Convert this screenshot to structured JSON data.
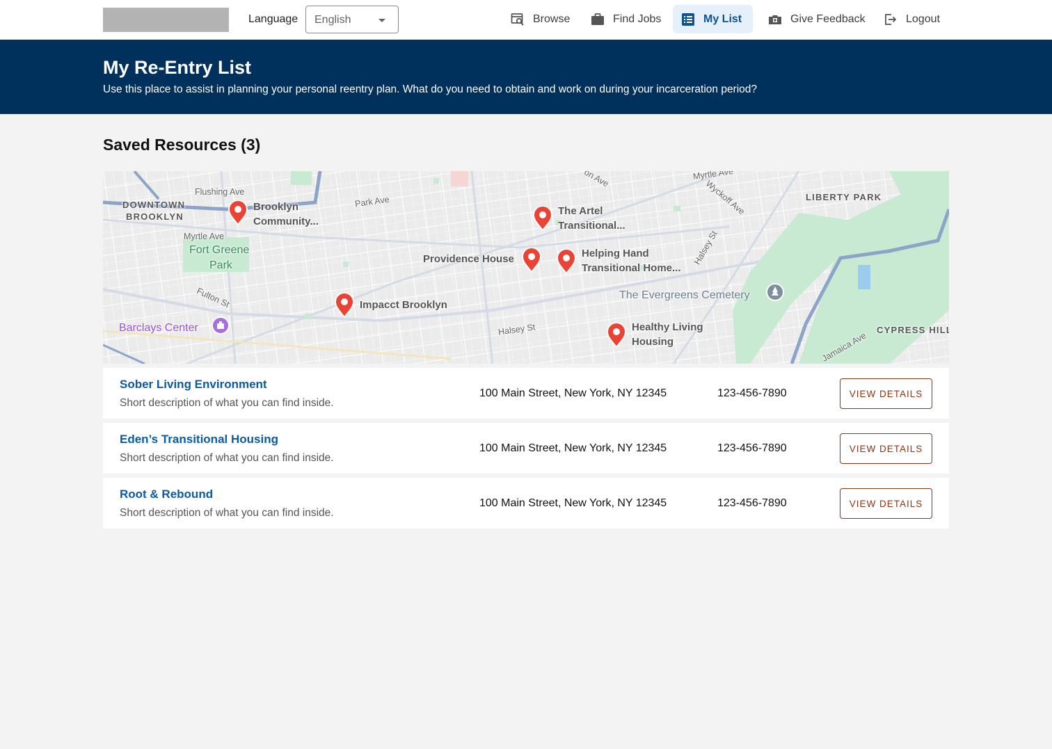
{
  "header": {
    "language_label": "Language",
    "language_value": "English",
    "nav": [
      {
        "label": "Browse",
        "icon": "browse-icon"
      },
      {
        "label": "Find Jobs",
        "icon": "briefcase-icon"
      },
      {
        "label": "My List",
        "icon": "list-icon",
        "active": true
      },
      {
        "label": "Give Feedback",
        "icon": "feedback-icon"
      },
      {
        "label": "Logout",
        "icon": "logout-icon"
      }
    ]
  },
  "banner": {
    "title": "My Re-Entry List",
    "subtitle": "Use this place to assist in planning your personal reentry plan. What do you need to obtain and work on during your incarceration period?"
  },
  "saved": {
    "title": "Saved Resources (3)"
  },
  "map": {
    "markers": [
      {
        "line1": "Brooklyn",
        "line2": "Community..."
      },
      {
        "line1": "The Artel",
        "line2": "Transitional..."
      },
      {
        "line1": "Providence House",
        "line2": ""
      },
      {
        "line1": "Helping Hand",
        "line2": "Transitional Home..."
      },
      {
        "line1": "Impacct Brooklyn",
        "line2": ""
      },
      {
        "line1": "Healthy Living",
        "line2": "Housing"
      }
    ],
    "places": {
      "downtown_1": "DOWNTOWN",
      "downtown_2": "BROOKLYN",
      "fort_greene_1": "Fort Greene",
      "fort_greene_2": "Park",
      "barclays": "Barclays Center",
      "evergreens": "The Evergreens Cemetery",
      "liberty": "LIBERTY PARK",
      "cypress": "CYPRESS HILL"
    },
    "streets": {
      "flushing": "Flushing Ave",
      "park": "Park Ave",
      "myrtle_w": "Myrtle Ave",
      "myrtle_e": "Myrtle Ave",
      "fulton": "Fulton St",
      "halsey_st": "Halsey St",
      "wyckoff": "Wyckoff Ave",
      "halsey_ne": "Halsey St",
      "jamaica": "Jamaica Ave",
      "on_ave": "on Ave"
    },
    "colors": {
      "marker": "#ea4335",
      "park": "#c8ead2",
      "highway": "#8da4c9"
    }
  },
  "resources": [
    {
      "name": "Sober Living Environment",
      "description": "Short description of what you can find inside.",
      "address": "100 Main Street, New York, NY 12345",
      "phone": "123-456-7890",
      "button": "VIEW DETAILS"
    },
    {
      "name": "Eden’s Transitional Housing",
      "description": "Short description of what you can find inside.",
      "address": "100 Main Street, New York, NY 12345",
      "phone": "123-456-7890",
      "button": "VIEW DETAILS"
    },
    {
      "name": "Root & Rebound",
      "description": "Short description of what you can find inside.",
      "address": "100 Main Street, New York, NY 12345",
      "phone": "123-456-7890",
      "button": "VIEW DETAILS"
    }
  ]
}
